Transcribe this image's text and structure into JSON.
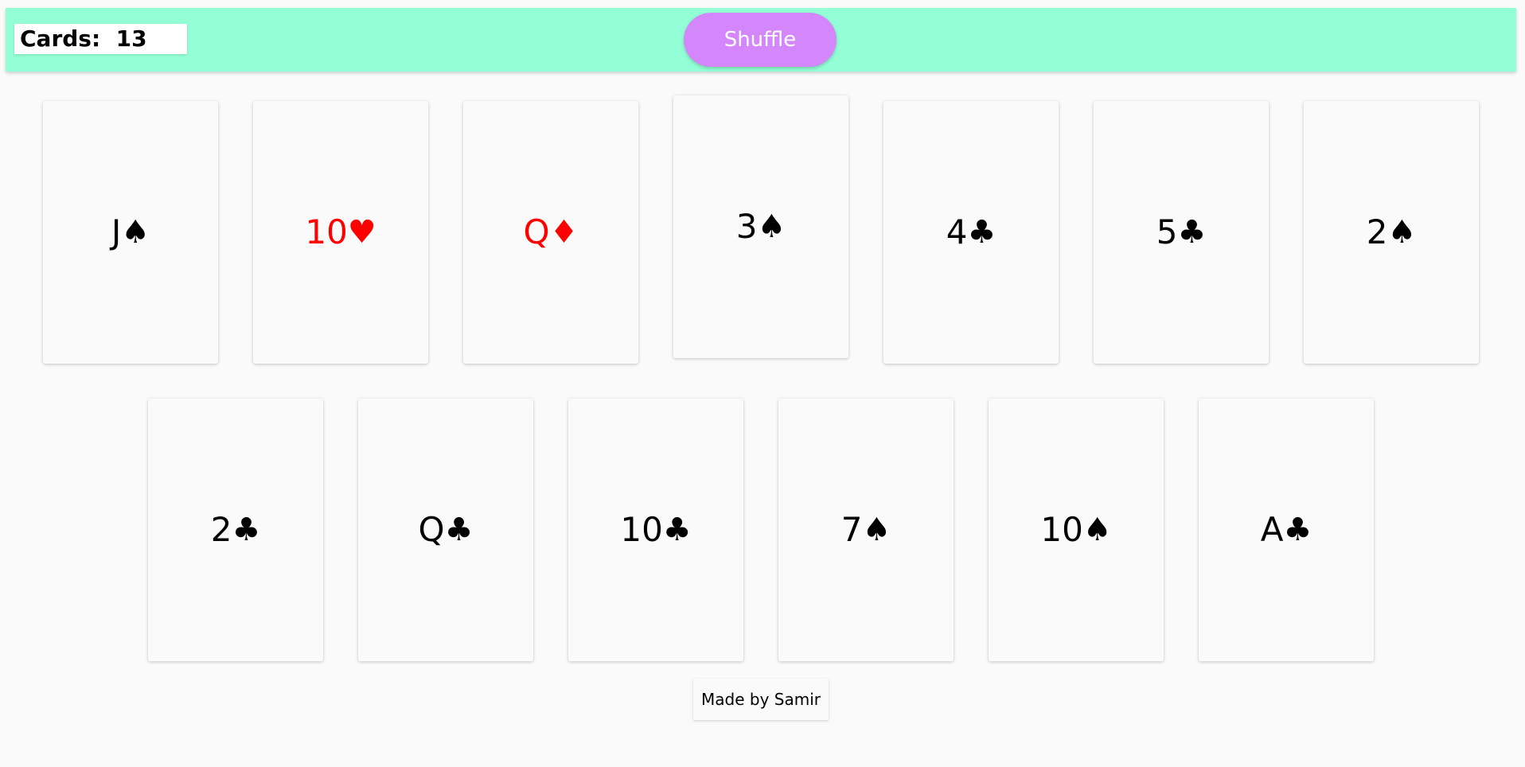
{
  "header": {
    "count_label": "Cards:",
    "count": "13",
    "shuffle_label": "Shuffle"
  },
  "colors": {
    "header_bg": "#93ffd6",
    "button_bg": "#d387fb",
    "red_suit": "#ff0000",
    "black_suit": "#000000"
  },
  "cards": [
    {
      "rank": "J",
      "suit": "♠",
      "suit_name": "spades",
      "color": "black"
    },
    {
      "rank": "10",
      "suit": "♥",
      "suit_name": "hearts",
      "color": "red"
    },
    {
      "rank": "Q",
      "suit": "♦",
      "suit_name": "diamonds",
      "color": "red"
    },
    {
      "rank": "3",
      "suit": "♠",
      "suit_name": "spades",
      "color": "black"
    },
    {
      "rank": "4",
      "suit": "♣",
      "suit_name": "clubs",
      "color": "black"
    },
    {
      "rank": "5",
      "suit": "♣",
      "suit_name": "clubs",
      "color": "black"
    },
    {
      "rank": "2",
      "suit": "♠",
      "suit_name": "spades",
      "color": "black"
    },
    {
      "rank": "2",
      "suit": "♣",
      "suit_name": "clubs",
      "color": "black"
    },
    {
      "rank": "Q",
      "suit": "♣",
      "suit_name": "clubs",
      "color": "black"
    },
    {
      "rank": "10",
      "suit": "♣",
      "suit_name": "clubs",
      "color": "black"
    },
    {
      "rank": "7",
      "suit": "♠",
      "suit_name": "spades",
      "color": "black"
    },
    {
      "rank": "10",
      "suit": "♠",
      "suit_name": "spades",
      "color": "black"
    },
    {
      "rank": "A",
      "suit": "♣",
      "suit_name": "clubs",
      "color": "black"
    }
  ],
  "footer": {
    "credit": "Made by Samir"
  }
}
